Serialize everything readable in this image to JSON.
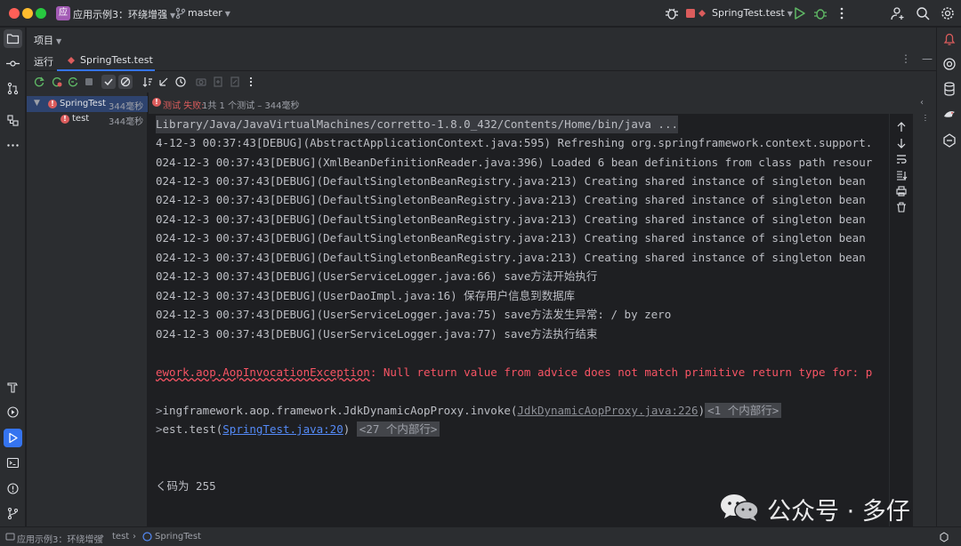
{
  "titlebar": {
    "project_badge": "应",
    "project_name": "应用示例3：环绕增强",
    "branch": "master",
    "run_config": "SpringTest.test"
  },
  "panels": {
    "project_label": "项目",
    "run_label": "运行",
    "run_tab": "SpringTest.test"
  },
  "tree": {
    "root": {
      "name": "SpringTest",
      "time": "344毫秒"
    },
    "child": {
      "name": "test",
      "time": "344毫秒"
    }
  },
  "status": {
    "failed": "测试 失败:",
    "summary": "1共 1 个测试 – 344毫秒"
  },
  "console": {
    "cmd": "Library/Java/JavaVirtualMachines/corretto-1.8.0_432/Contents/Home/bin/java ...",
    "logs": [
      "4-12-3 00:37:43[DEBUG](AbstractApplicationContext.java:595) Refreshing org.springframework.context.support.",
      "024-12-3 00:37:43[DEBUG](XmlBeanDefinitionReader.java:396) Loaded 6 bean definitions from class path resour",
      "024-12-3 00:37:43[DEBUG](DefaultSingletonBeanRegistry.java:213) Creating shared instance of singleton bean",
      "024-12-3 00:37:43[DEBUG](DefaultSingletonBeanRegistry.java:213) Creating shared instance of singleton bean",
      "024-12-3 00:37:43[DEBUG](DefaultSingletonBeanRegistry.java:213) Creating shared instance of singleton bean",
      "024-12-3 00:37:43[DEBUG](DefaultSingletonBeanRegistry.java:213) Creating shared instance of singleton bean",
      "024-12-3 00:37:43[DEBUG](DefaultSingletonBeanRegistry.java:213) Creating shared instance of singleton bean",
      "024-12-3 00:37:43[DEBUG](UserServiceLogger.java:66) save方法开始执行",
      "024-12-3 00:37:43[DEBUG](UserDaoImpl.java:16) 保存用户信息到数据库",
      "024-12-3 00:37:43[DEBUG](UserServiceLogger.java:75) save方法发生异常: / by zero",
      "024-12-3 00:37:43[DEBUG](UserServiceLogger.java:77) save方法执行结束"
    ],
    "exception_class": "ework.aop.AopInvocationException",
    "exception_msg": ": Null return value from advice does not match primitive return type for: p",
    "trace1_prefix": "ingframework.aop.framework.JdkDynamicAopProxy.invoke(",
    "trace1_link": "JdkDynamicAopProxy.java:226",
    "trace1_close": ")",
    "trace1_fold": "<1 个内部行>",
    "trace2_prefix": "est.test(",
    "trace2_link": "SpringTest.java:20",
    "trace2_close": ")",
    "trace2_fold": "<27 个内部行>",
    "exit": "码为 255",
    "exit_prefix": "く"
  },
  "watermark": "公众号 · 多仔",
  "statusbar": {
    "crumb1": "应用示例3：环绕增强",
    "crumb2": "test",
    "crumb3": "SpringTest"
  },
  "colors": {
    "accent": "#3574f0",
    "error": "#f75464",
    "link": "#548af7"
  }
}
